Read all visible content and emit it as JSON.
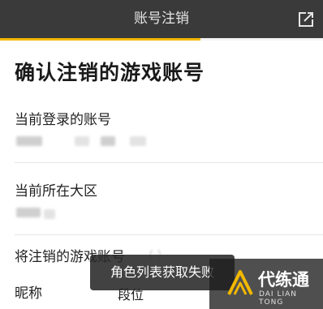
{
  "header": {
    "title": "账号注销",
    "share_icon": "share-icon"
  },
  "progress": {
    "fraction": 0.62,
    "color": "#f2b800"
  },
  "page": {
    "heading": "确认注销的游戏账号",
    "current_account_label": "当前登录的账号",
    "current_region_label": "当前所在大区",
    "game_account_label": "将注销的游戏账号",
    "nickname_col": "昵称",
    "rank_col": "段位"
  },
  "toast": {
    "message": "角色列表获取失败"
  },
  "watermark": {
    "name": "代练通",
    "subtitle": "DAI LIAN TONG",
    "icon": "daliantong-logo-icon"
  }
}
